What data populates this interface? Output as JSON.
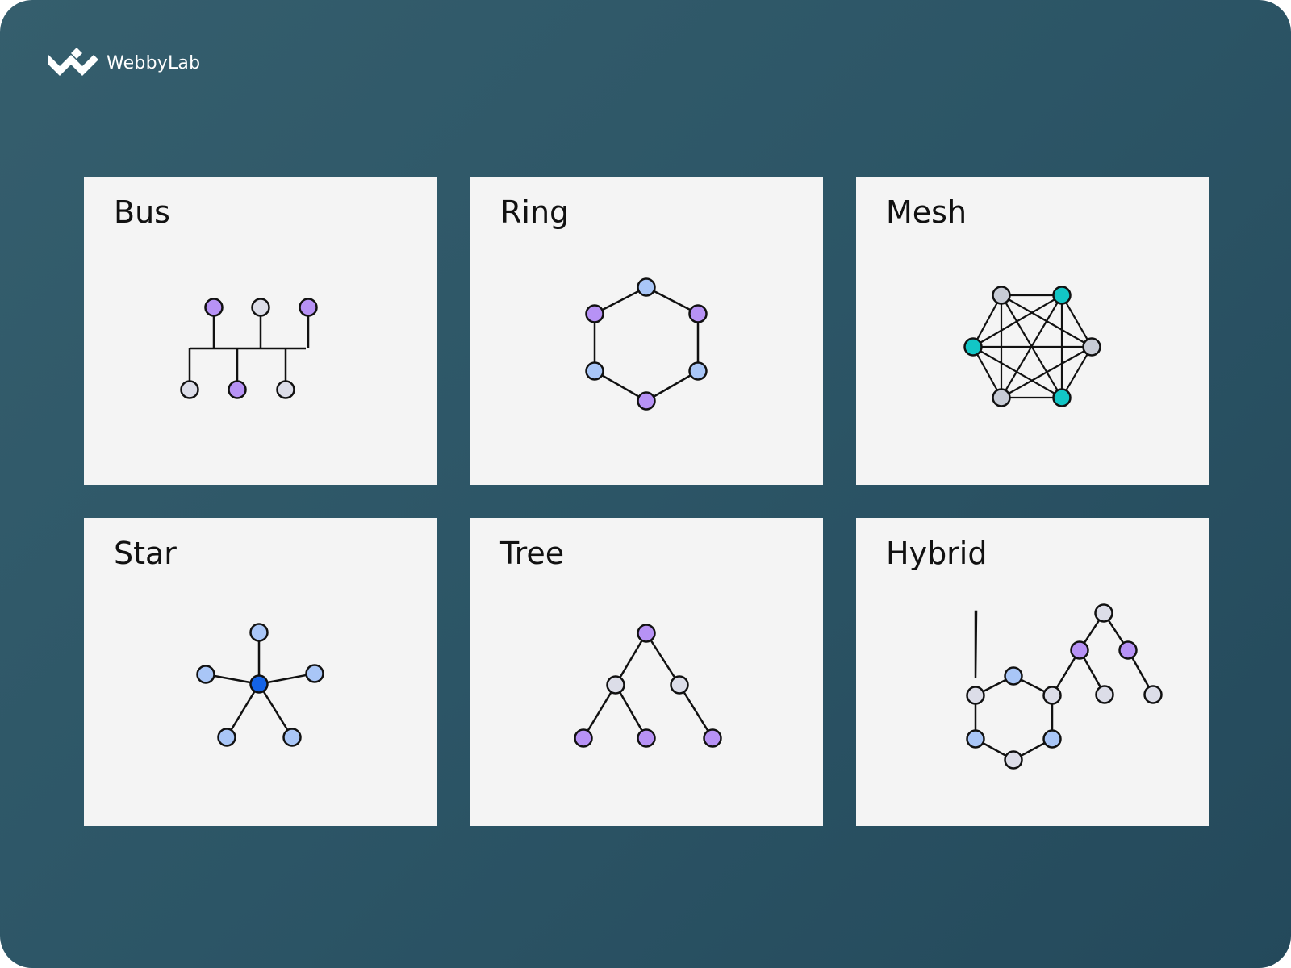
{
  "brand": {
    "name": "WebbyLab"
  },
  "colors": {
    "purple": "#b792f5",
    "light_gray": "#dcdde8",
    "gray": "#c8ccd6",
    "light_blue": "#a9c6f7",
    "blue": "#1463e6",
    "teal": "#12c6c6",
    "line": "#111111"
  },
  "topologies": [
    {
      "key": "bus",
      "title": "Bus"
    },
    {
      "key": "ring",
      "title": "Ring"
    },
    {
      "key": "mesh",
      "title": "Mesh"
    },
    {
      "key": "star",
      "title": "Star"
    },
    {
      "key": "tree",
      "title": "Tree"
    },
    {
      "key": "hybrid",
      "title": "Hybrid"
    }
  ]
}
